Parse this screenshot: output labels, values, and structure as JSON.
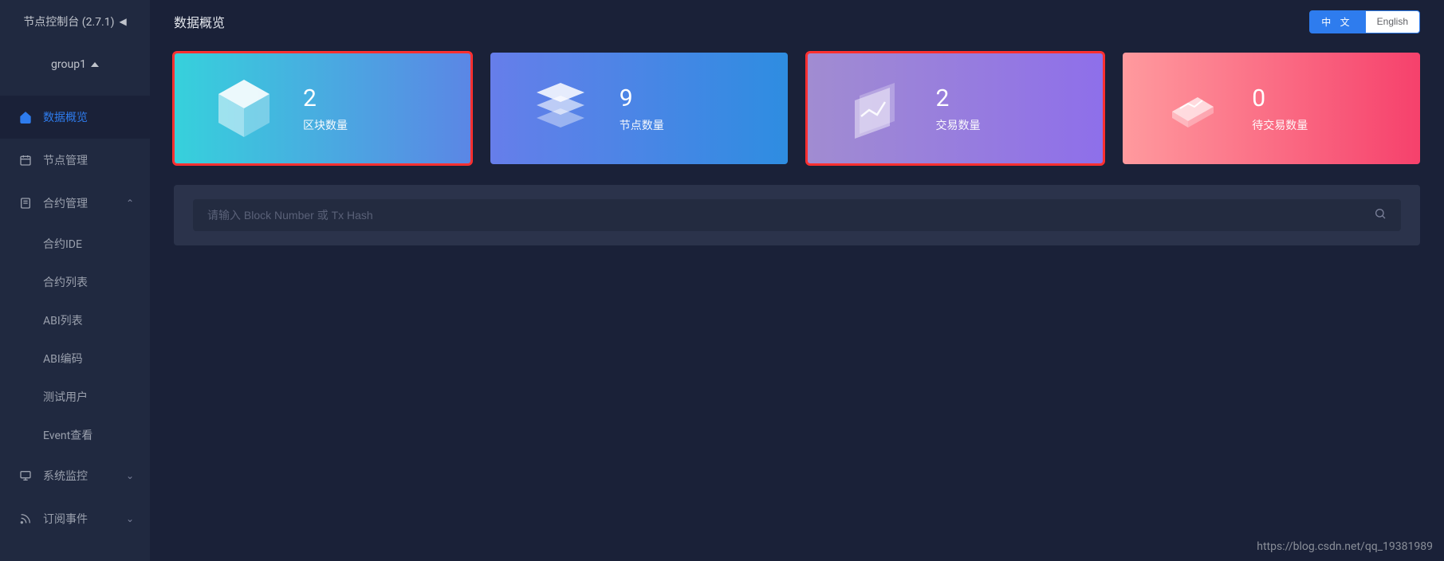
{
  "sidebar": {
    "app_title": "节点控制台 (2.7.1)",
    "group": "group1",
    "items": [
      {
        "label": "数据概览"
      },
      {
        "label": "节点管理"
      },
      {
        "label": "合约管理"
      },
      {
        "label": "系统监控"
      },
      {
        "label": "订阅事件"
      }
    ],
    "contract_sub": [
      {
        "label": "合约IDE"
      },
      {
        "label": "合约列表"
      },
      {
        "label": "ABI列表"
      },
      {
        "label": "ABI编码"
      },
      {
        "label": "测试用户"
      },
      {
        "label": "Event查看"
      }
    ]
  },
  "header": {
    "title": "数据概览",
    "lang_zh": "中 文",
    "lang_en": "English"
  },
  "cards": [
    {
      "value": "2",
      "label": "区块数量"
    },
    {
      "value": "9",
      "label": "节点数量"
    },
    {
      "value": "2",
      "label": "交易数量"
    },
    {
      "value": "0",
      "label": "待交易数量"
    }
  ],
  "search": {
    "placeholder": "请输入 Block Number 或 Tx Hash"
  },
  "watermark": "https://blog.csdn.net/qq_19381989"
}
